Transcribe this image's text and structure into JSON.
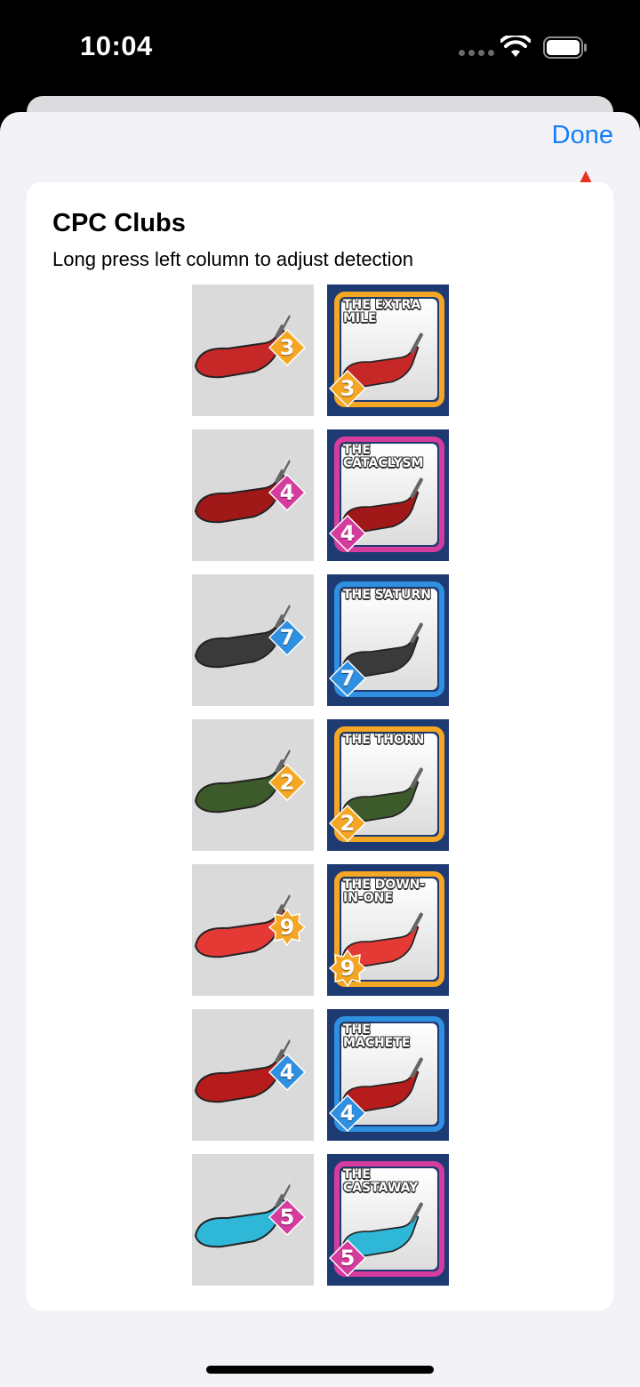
{
  "status_bar": {
    "time": "10:04"
  },
  "sheet": {
    "done_label": "Done"
  },
  "card": {
    "title": "CPC Clubs",
    "subtitle": "Long press left column to adjust detection"
  },
  "clubs": [
    {
      "name": "The Extra Mile",
      "level": "3",
      "rarity_color": "#f5a623",
      "head_color": "#c62828",
      "badge_shape": "diamond"
    },
    {
      "name": "The Cataclysm",
      "level": "4",
      "rarity_color": "#d63b9e",
      "head_color": "#a01818",
      "badge_shape": "diamond"
    },
    {
      "name": "The Saturn",
      "level": "7",
      "rarity_color": "#2f8fe0",
      "head_color": "#3a3a3a",
      "badge_shape": "diamond"
    },
    {
      "name": "The Thorn",
      "level": "2",
      "rarity_color": "#f5a623",
      "head_color": "#3d5a2a",
      "badge_shape": "diamond"
    },
    {
      "name": "The Down-in-One",
      "level": "9",
      "rarity_color": "#f5a623",
      "head_color": "#e53935",
      "badge_shape": "star"
    },
    {
      "name": "The Machete",
      "level": "4",
      "rarity_color": "#2f8fe0",
      "head_color": "#b71c1c",
      "badge_shape": "diamond"
    },
    {
      "name": "The Castaway",
      "level": "5",
      "rarity_color": "#d63b9e",
      "head_color": "#2fb7d8",
      "badge_shape": "diamond"
    }
  ]
}
